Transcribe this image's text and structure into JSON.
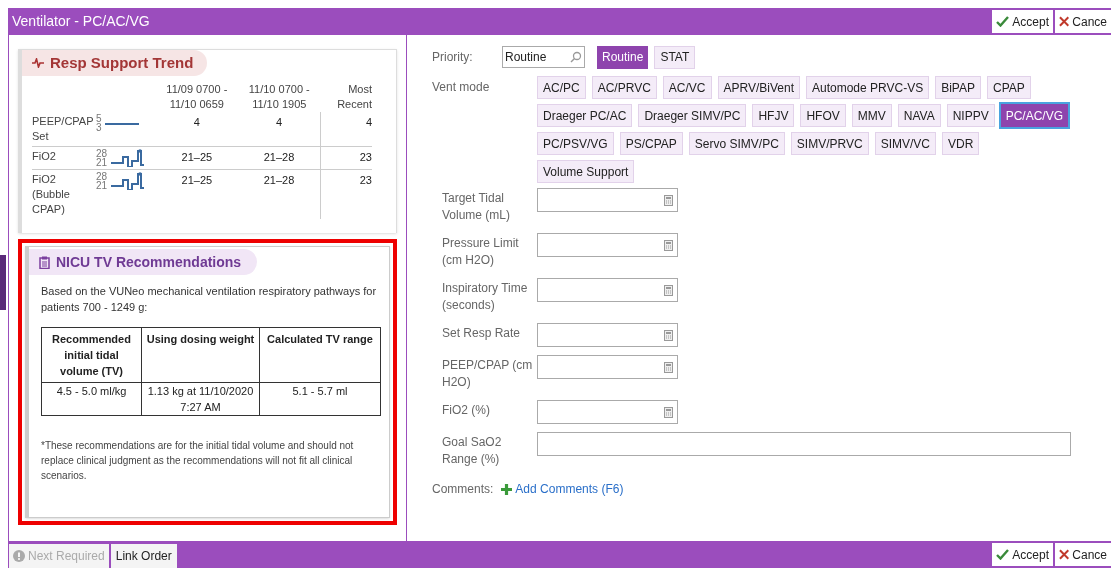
{
  "window": {
    "title": "Ventilator - PC/AC/VG"
  },
  "header_buttons": [
    {
      "kind": "accept",
      "label": "Accept"
    },
    {
      "kind": "cancel",
      "label": "Cance"
    }
  ],
  "trend": {
    "title": "Resp Support Trend",
    "columns": [
      "11/09 0700 - 11/10 0659",
      "11/10 0700 - 11/10 1905",
      "Most Recent"
    ],
    "rows": [
      {
        "label": "PEEP/CPAP Set",
        "max": "5",
        "min": "3",
        "cells": [
          "4",
          "4",
          "4"
        ]
      },
      {
        "label": "FiO2",
        "max": "28",
        "min": "21",
        "cells": [
          "21–25",
          "21–28",
          "23"
        ]
      },
      {
        "label": "FiO2 (Bubble CPAP)",
        "max": "28",
        "min": "21",
        "cells": [
          "21–25",
          "21–28",
          "23"
        ]
      }
    ]
  },
  "recommendations": {
    "title": "NICU TV Recommendations",
    "highlighted": true,
    "intro": "Based on the VUNeo mechanical ventilation respiratory pathways for patients 700 - 1249 g:",
    "columns": [
      "Recommended initial tidal volume (TV)",
      "Using dosing weight",
      "Calculated TV range"
    ],
    "row": [
      "4.5 - 5.0 ml/kg",
      "1.13 kg at 11/10/2020  7:27 AM",
      "5.1 - 5.7 ml"
    ],
    "note": "*These recommendations are for the initial tidal volume and should not replace clinical judgment as the recommendations will not fit all clinical scenarios."
  },
  "priority": {
    "label": "Priority:",
    "value": "Routine",
    "options": [
      {
        "label": "Routine",
        "selected": true
      },
      {
        "label": "STAT",
        "selected": false
      }
    ]
  },
  "vent_mode": {
    "label": "Vent mode",
    "options": [
      {
        "label": "AC/PC",
        "selected": false
      },
      {
        "label": "AC/PRVC",
        "selected": false
      },
      {
        "label": "AC/VC",
        "selected": false
      },
      {
        "label": "APRV/BiVent",
        "selected": false
      },
      {
        "label": "Automode PRVC-VS",
        "selected": false
      },
      {
        "label": "BiPAP",
        "selected": false
      },
      {
        "label": "CPAP",
        "selected": false
      },
      {
        "label": "Draeger PC/AC",
        "selected": false
      },
      {
        "label": "Draeger SIMV/PC",
        "selected": false
      },
      {
        "label": "HFJV",
        "selected": false
      },
      {
        "label": "HFOV",
        "selected": false
      },
      {
        "label": "MMV",
        "selected": false
      },
      {
        "label": "NAVA",
        "selected": false
      },
      {
        "label": "NIPPV",
        "selected": false
      },
      {
        "label": "PC/AC/VG",
        "selected": true
      },
      {
        "label": "PC/PSV/VG",
        "selected": false
      },
      {
        "label": "PS/CPAP",
        "selected": false
      },
      {
        "label": "Servo SIMV/PC",
        "selected": false
      },
      {
        "label": "SIMV/PRVC",
        "selected": false
      },
      {
        "label": "SIMV/VC",
        "selected": false
      },
      {
        "label": "VDR",
        "selected": false
      },
      {
        "label": "Volume Support",
        "selected": false
      }
    ]
  },
  "fields": [
    {
      "kind": "numeric",
      "label": "Target Tidal Volume (mL)"
    },
    {
      "kind": "numeric",
      "label": "Pressure Limit (cm H2O)"
    },
    {
      "kind": "numeric",
      "label": "Inspiratory Time (seconds)"
    },
    {
      "kind": "numeric",
      "label": "Set Resp Rate"
    },
    {
      "kind": "numeric",
      "label": "PEEP/CPAP (cm H2O)"
    },
    {
      "kind": "numeric",
      "label": "FiO2 (%)"
    },
    {
      "kind": "text",
      "label": "Goal SaO2 Range (%)"
    }
  ],
  "comments": {
    "label": "Comments:",
    "link": "Add Comments (F6)"
  },
  "footer": {
    "next_required": {
      "label": "Next Required",
      "disabled": true
    },
    "link_order": "Link Order"
  },
  "footer_buttons": [
    {
      "kind": "accept",
      "label": "Accept"
    },
    {
      "kind": "cancel",
      "label": "Cance"
    }
  ]
}
